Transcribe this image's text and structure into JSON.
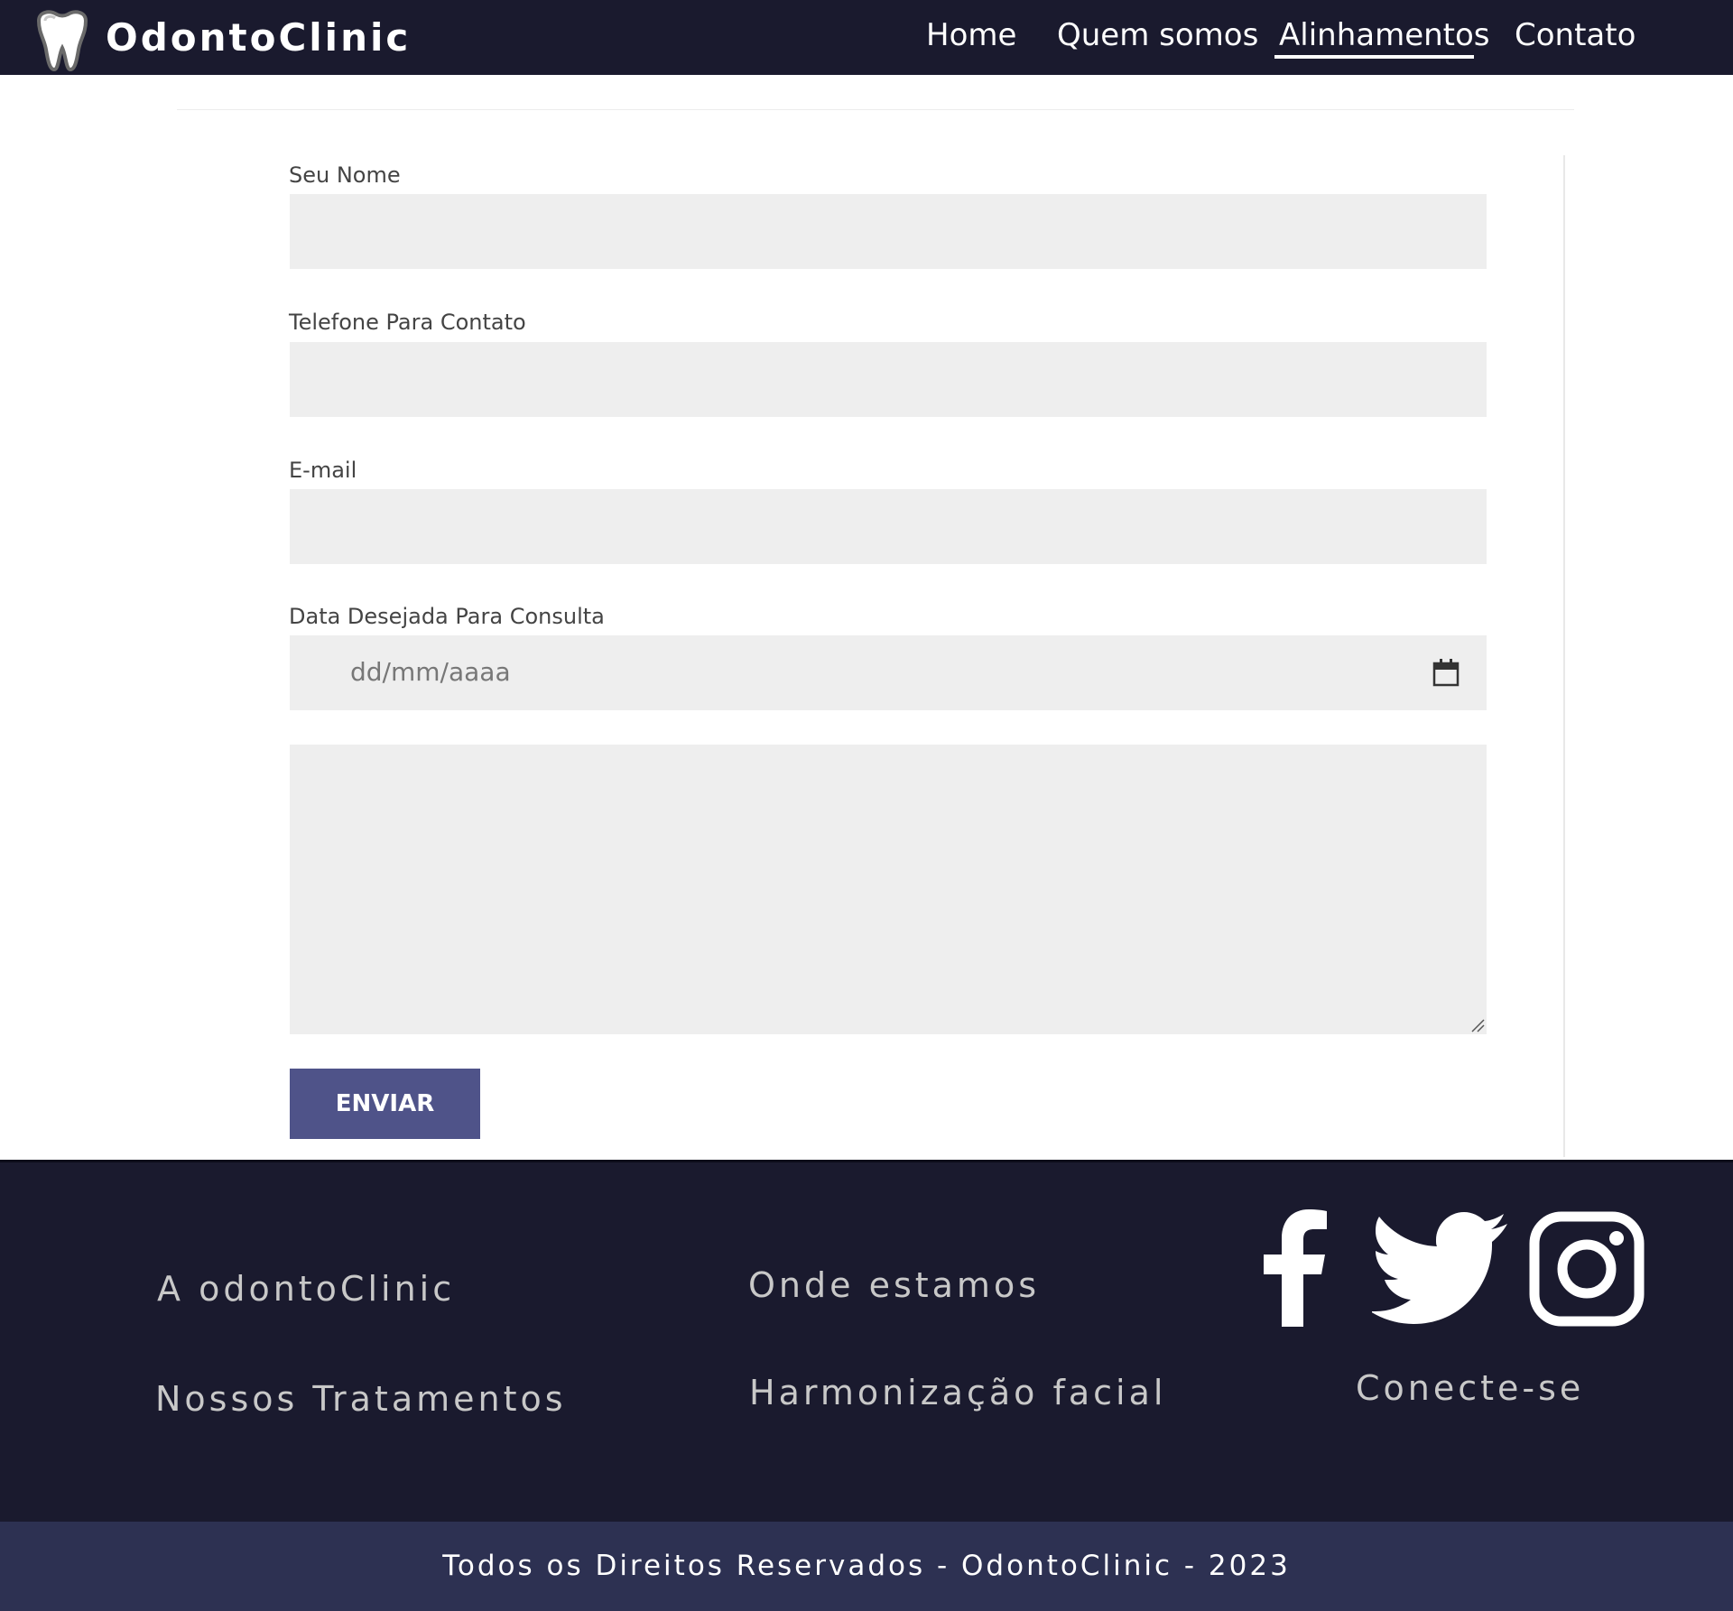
{
  "header": {
    "brand": "OdontoClinic",
    "nav": [
      {
        "label": "Home"
      },
      {
        "label": "Quem somos"
      },
      {
        "label": "Alinhamentos"
      },
      {
        "label": "Contato"
      }
    ],
    "active_nav": "Alinhamentos"
  },
  "form": {
    "name_label": "Seu Nome",
    "name_value": "",
    "phone_label": "Telefone Para Contato",
    "phone_value": "",
    "email_label": "E-mail",
    "email_value": "",
    "date_label": "Data Desejada Para Consulta",
    "date_placeholder": "dd/mm/aaaa",
    "message_value": "",
    "submit_label": "ENVIAR"
  },
  "footer": {
    "links_col1": [
      "A odontoClinic",
      "Nossos Tratamentos"
    ],
    "links_col2": [
      "Onde estamos",
      "Harmonização facial"
    ],
    "social_icons": [
      "facebook-icon",
      "twitter-icon",
      "instagram-icon"
    ],
    "connect_label": "Conecte-se",
    "copyright": "Todos os Direitos Reservados - OdontoClinic - 2023"
  },
  "colors": {
    "header_bg": "#1a1a2e",
    "footer_bg": "#1a1a2e",
    "copyright_bg": "#2d3152",
    "button_bg": "#4f5389",
    "field_bg": "#eeeeee"
  }
}
